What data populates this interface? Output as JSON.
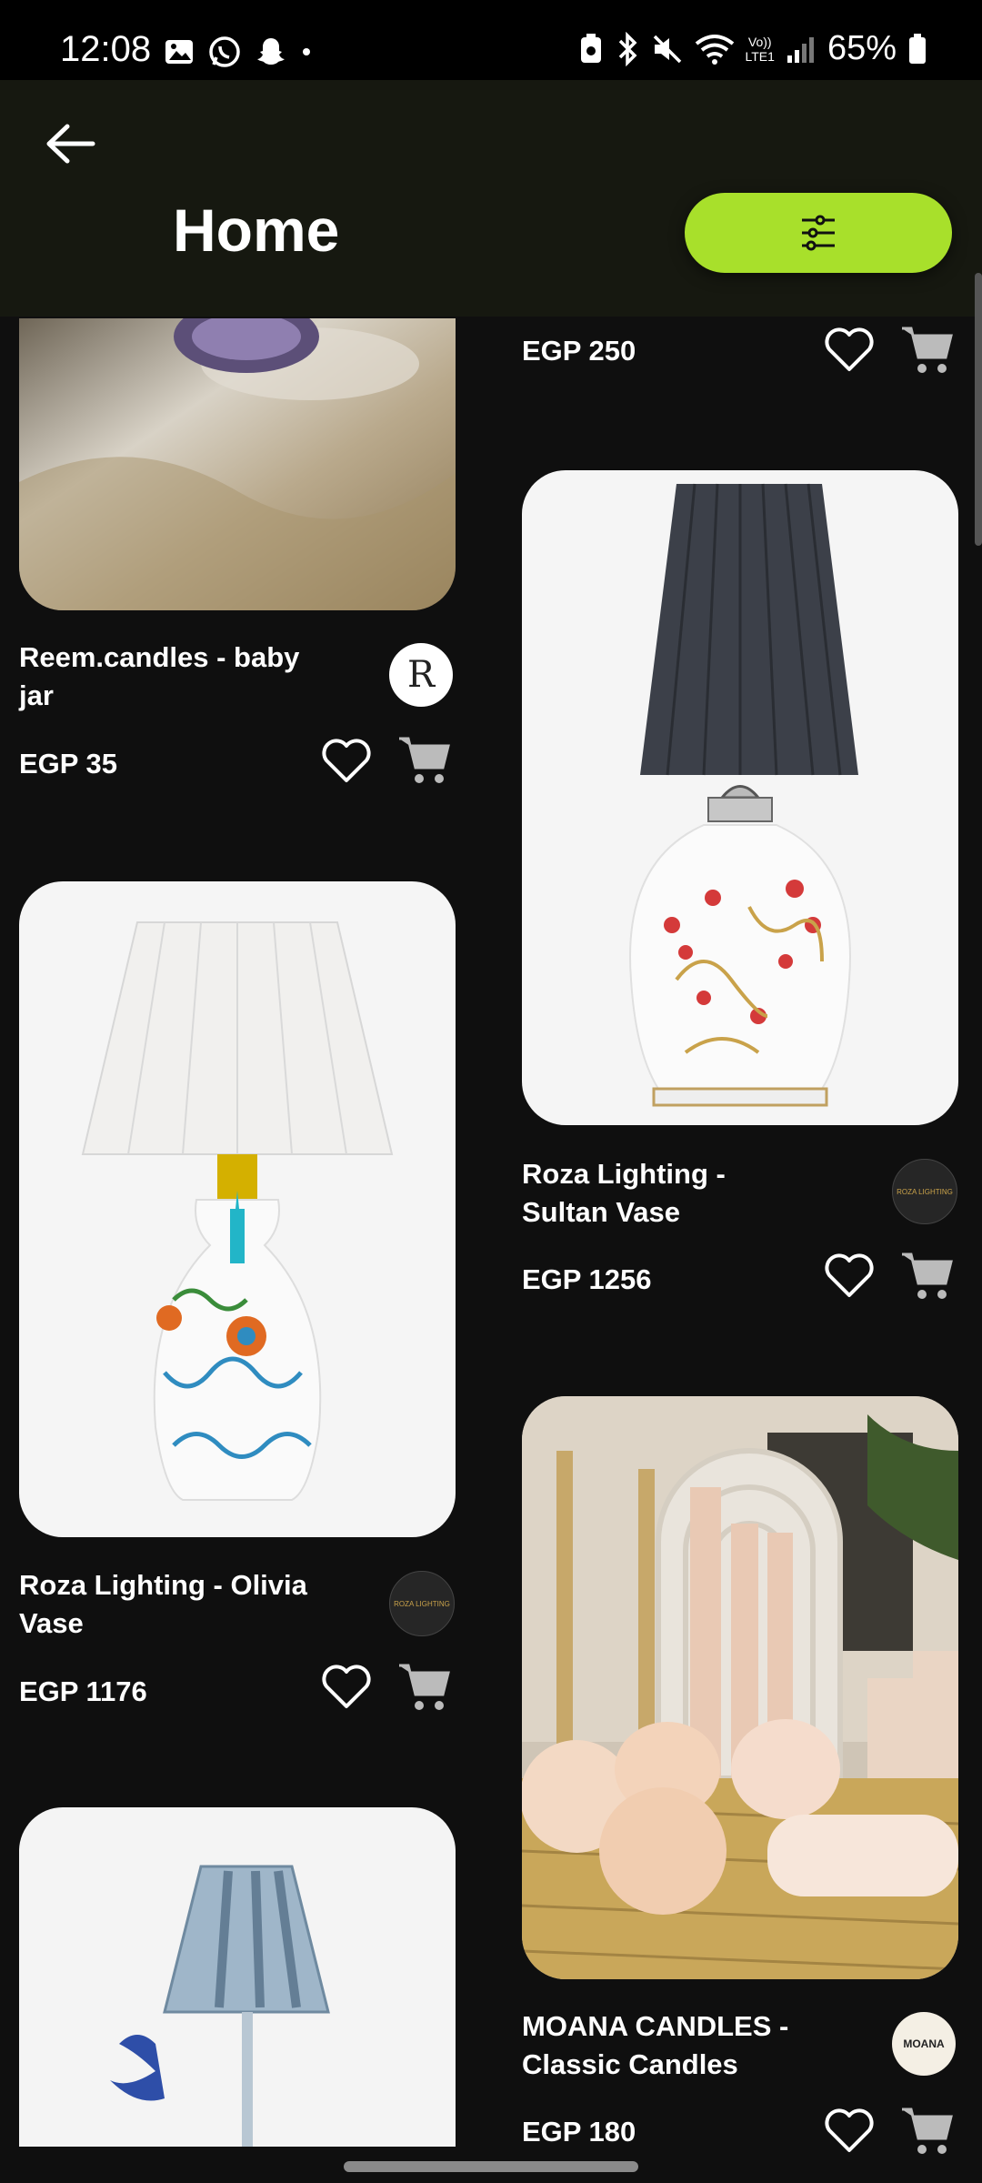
{
  "status": {
    "time": "12:08",
    "battery": "65%",
    "volte_label": "Vo))",
    "lte_label": "LTE1"
  },
  "header": {
    "title": "Home"
  },
  "products": [
    {
      "name": "",
      "price": "EGP 250"
    },
    {
      "name": "Reem.candles - baby jar",
      "price": "EGP 35",
      "logo_text": "R"
    },
    {
      "name": "Roza Lighting - Sultan Vase",
      "price": "EGP 1256",
      "logo_text": "ROZA LIGHTING"
    },
    {
      "name": "Roza Lighting - Olivia Vase",
      "price": "EGP 1176",
      "logo_text": "ROZA LIGHTING"
    },
    {
      "name": "MOANA CANDLES - Classic Candles",
      "price": "EGP 180",
      "logo_text": "MOANA"
    }
  ],
  "colors": {
    "accent": "#a8e02b",
    "background": "#0f0f0f",
    "header": "#161810"
  }
}
